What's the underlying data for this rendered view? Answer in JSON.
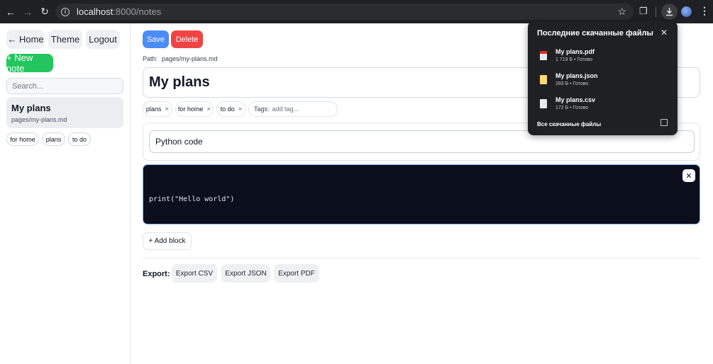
{
  "browser": {
    "url_host": "localhost",
    "url_path": ":8000/notes"
  },
  "sidebar": {
    "home_label": "← Home",
    "theme_label": "Theme",
    "logout_label": "Logout",
    "new_note_label": "+ New note",
    "search_placeholder": "Search...",
    "notes": [
      {
        "title": "My plans",
        "path": "pages/my-plans.md"
      }
    ],
    "tags": [
      "for home",
      "plans",
      "to do"
    ]
  },
  "editor": {
    "save_label": "Save",
    "delete_label": "Delete",
    "path_label": "Path:",
    "path_value": "pages/my-plans.md",
    "title": "My plans",
    "tags": [
      "plans",
      "for home",
      "to do"
    ],
    "tags_label": "Tags:",
    "tag_placeholder": "add tag...",
    "blocks": [
      {
        "type": "heading",
        "text": "Python code"
      },
      {
        "type": "code",
        "text": "print(\"Hello world\")"
      }
    ],
    "add_block_label": "+ Add block",
    "export_label": "Export:",
    "export_buttons": [
      "Export CSV",
      "Export JSON",
      "Export PDF"
    ]
  },
  "downloads": {
    "title": "Последние скачанные файлы",
    "items": [
      {
        "name": "My plans.pdf",
        "meta": "1 719 Б • Готово",
        "icon": "pdf-file-icon"
      },
      {
        "name": "My plans.json",
        "meta": "283 Б • Готово",
        "icon": "json-file-icon"
      },
      {
        "name": "My plans.csv",
        "meta": "172 Б • Готово",
        "icon": "csv-file-icon"
      }
    ],
    "footer": "Все скачанные файлы"
  },
  "colors": {
    "primary": "#4b8cf7",
    "danger": "#ef4444",
    "success": "#22c55e",
    "code_bg": "#0b0f1c"
  }
}
